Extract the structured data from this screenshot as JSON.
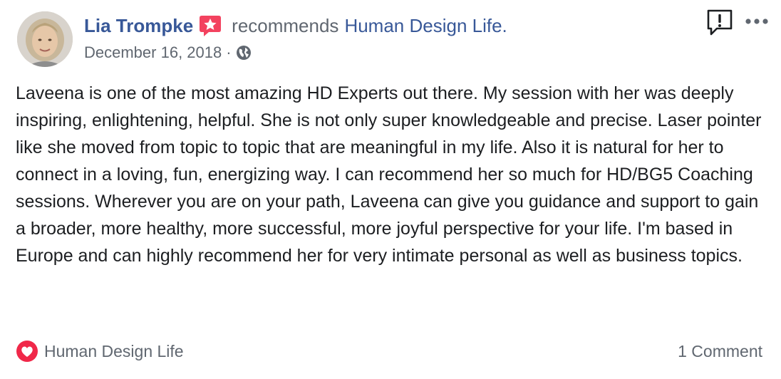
{
  "post": {
    "author_name": "Lia Trompke",
    "action_text": "recommends",
    "page_name": "Human Design Life.",
    "date": "December 16, 2018",
    "separator": "·",
    "body": "Laveena is one of the most amazing HD Experts out there. My session with her was deeply inspiring, enlightening, helpful. She is not only super knowledgeable and precise. Laser pointer like she moved from topic to topic that are meaningful in my life. Also it is natural for her to connect in a loving, fun, energizing way. I can recommend her so much for HD/BG5 Coaching sessions. Wherever you are on your path, Laveena can give you guidance and support to gain a broader, more healthy, more successful, more joyful perspective for your life. I'm based in Europe and can highly recommend her for very intimate personal as well as business topics."
  },
  "footer": {
    "reaction_page": "Human Design Life",
    "comments": "1 Comment"
  },
  "icons": {
    "recommend_badge": "recommend-star-icon",
    "audience": "globe-icon",
    "report": "report-exclamation-icon",
    "more": "more-options-icon",
    "reaction": "heart-reaction-icon"
  },
  "colors": {
    "link": "#385898",
    "secondary_text": "#606770",
    "body_text": "#1c1e21",
    "recommend_badge": "#f3425f",
    "heart": "#f02849"
  }
}
